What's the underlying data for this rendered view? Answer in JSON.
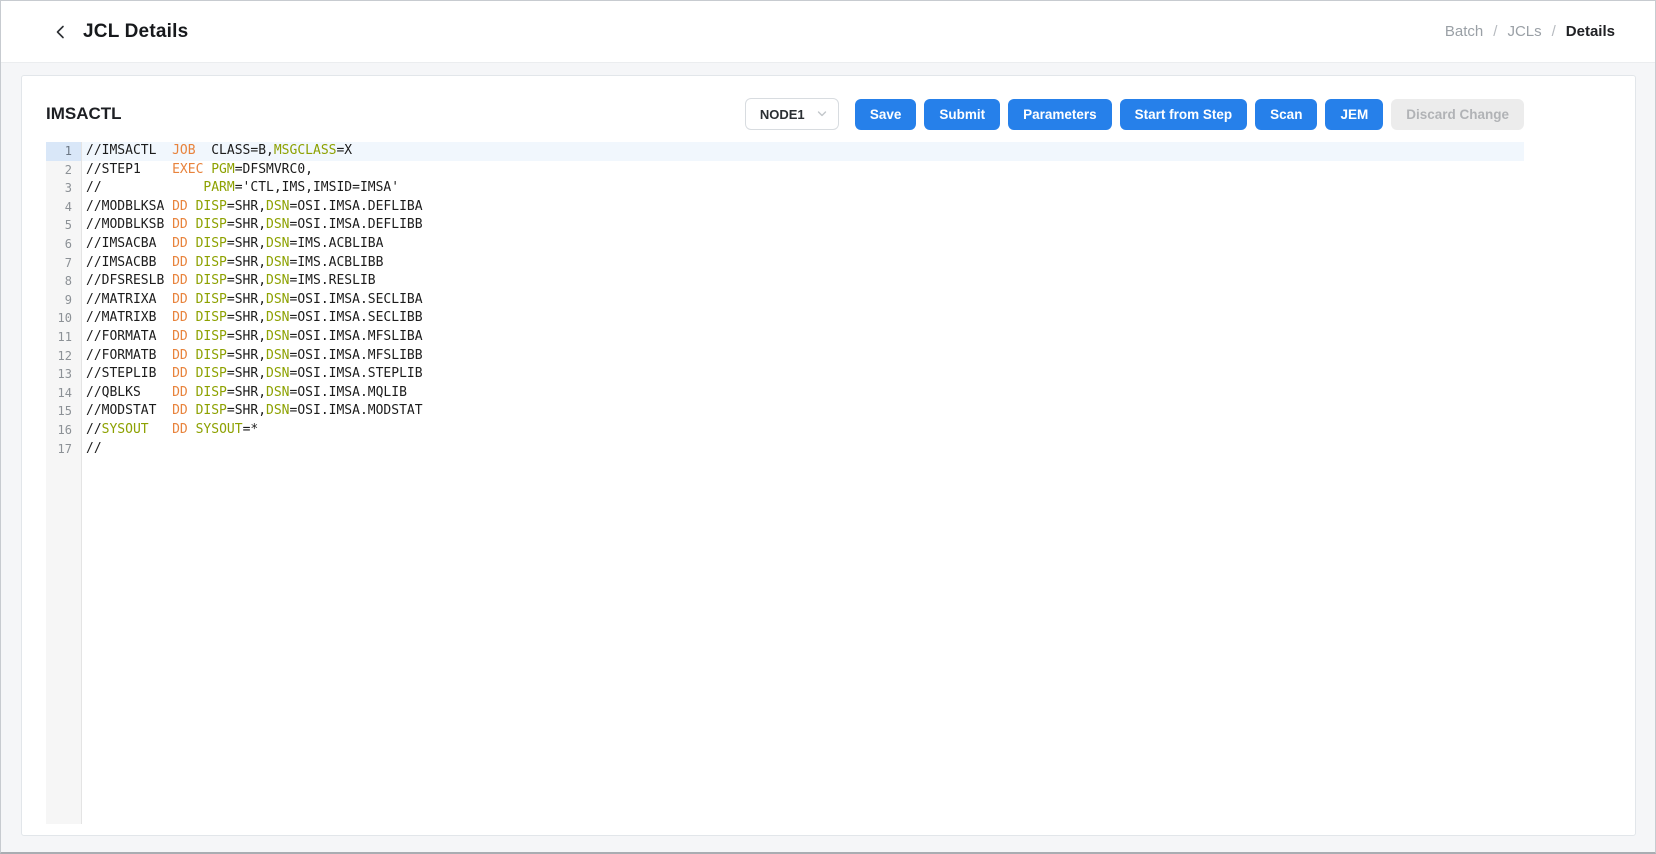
{
  "colors": {
    "accent_blue": "#2680EA",
    "keyword_orange": "#E8833C",
    "keyword_green": "#8DA101",
    "code_text": "#1C1C1C",
    "active_line_bg": "#F1F7FD",
    "active_gutter_bg": "#D9E7F8"
  },
  "header": {
    "title": "JCL Details",
    "back_icon": "chevron-left-icon",
    "breadcrumb": {
      "separator": "/",
      "items": [
        {
          "label": "Batch",
          "active": false
        },
        {
          "label": "JCLs",
          "active": false
        },
        {
          "label": "Details",
          "active": true
        }
      ]
    }
  },
  "card": {
    "title": "IMSACTL",
    "toolbar": {
      "node_select": {
        "value": "NODE1",
        "chevron_icon": "chevron-down-icon"
      },
      "buttons": [
        {
          "label": "Save",
          "name": "save-button",
          "enabled": true
        },
        {
          "label": "Submit",
          "name": "submit-button",
          "enabled": true
        },
        {
          "label": "Parameters",
          "name": "parameters-button",
          "enabled": true
        },
        {
          "label": "Start from Step",
          "name": "start-from-step-button",
          "enabled": true
        },
        {
          "label": "Scan",
          "name": "scan-button",
          "enabled": true
        },
        {
          "label": "JEM",
          "name": "jem-button",
          "enabled": true
        },
        {
          "label": "Discard Change",
          "name": "discard-change-button",
          "enabled": false
        }
      ]
    }
  },
  "editor": {
    "active_line": 1,
    "line_count": 17,
    "lines": [
      {
        "no": 1,
        "segments": [
          {
            "text": "//IMSACTL  ",
            "style": "plain"
          },
          {
            "text": "JOB",
            "style": "operator"
          },
          {
            "text": "  CLASS=B,",
            "style": "plain"
          },
          {
            "text": "MSGCLASS",
            "style": "keyword"
          },
          {
            "text": "=X",
            "style": "plain"
          }
        ]
      },
      {
        "no": 2,
        "segments": [
          {
            "text": "//STEP1    ",
            "style": "plain"
          },
          {
            "text": "EXEC",
            "style": "operator"
          },
          {
            "text": " ",
            "style": "plain"
          },
          {
            "text": "PGM",
            "style": "keyword"
          },
          {
            "text": "=DFSMVRC0,",
            "style": "plain"
          }
        ]
      },
      {
        "no": 3,
        "segments": [
          {
            "text": "//             ",
            "style": "plain"
          },
          {
            "text": "PARM",
            "style": "keyword"
          },
          {
            "text": "='CTL,IMS,IMSID=IMSA'",
            "style": "plain"
          }
        ]
      },
      {
        "no": 4,
        "segments": [
          {
            "text": "//MODBLKSA ",
            "style": "plain"
          },
          {
            "text": "DD",
            "style": "operator"
          },
          {
            "text": " ",
            "style": "plain"
          },
          {
            "text": "DISP",
            "style": "keyword"
          },
          {
            "text": "=SHR,",
            "style": "plain"
          },
          {
            "text": "DSN",
            "style": "keyword"
          },
          {
            "text": "=OSI.IMSA.DEFLIBA",
            "style": "plain"
          }
        ]
      },
      {
        "no": 5,
        "segments": [
          {
            "text": "//MODBLKSB ",
            "style": "plain"
          },
          {
            "text": "DD",
            "style": "operator"
          },
          {
            "text": " ",
            "style": "plain"
          },
          {
            "text": "DISP",
            "style": "keyword"
          },
          {
            "text": "=SHR,",
            "style": "plain"
          },
          {
            "text": "DSN",
            "style": "keyword"
          },
          {
            "text": "=OSI.IMSA.DEFLIBB",
            "style": "plain"
          }
        ]
      },
      {
        "no": 6,
        "segments": [
          {
            "text": "//IMSACBA  ",
            "style": "plain"
          },
          {
            "text": "DD",
            "style": "operator"
          },
          {
            "text": " ",
            "style": "plain"
          },
          {
            "text": "DISP",
            "style": "keyword"
          },
          {
            "text": "=SHR,",
            "style": "plain"
          },
          {
            "text": "DSN",
            "style": "keyword"
          },
          {
            "text": "=IMS.ACBLIBA",
            "style": "plain"
          }
        ]
      },
      {
        "no": 7,
        "segments": [
          {
            "text": "//IMSACBB  ",
            "style": "plain"
          },
          {
            "text": "DD",
            "style": "operator"
          },
          {
            "text": " ",
            "style": "plain"
          },
          {
            "text": "DISP",
            "style": "keyword"
          },
          {
            "text": "=SHR,",
            "style": "plain"
          },
          {
            "text": "DSN",
            "style": "keyword"
          },
          {
            "text": "=IMS.ACBLIBB",
            "style": "plain"
          }
        ]
      },
      {
        "no": 8,
        "segments": [
          {
            "text": "//DFSRESLB ",
            "style": "plain"
          },
          {
            "text": "DD",
            "style": "operator"
          },
          {
            "text": " ",
            "style": "plain"
          },
          {
            "text": "DISP",
            "style": "keyword"
          },
          {
            "text": "=SHR,",
            "style": "plain"
          },
          {
            "text": "DSN",
            "style": "keyword"
          },
          {
            "text": "=IMS.RESLIB",
            "style": "plain"
          }
        ]
      },
      {
        "no": 9,
        "segments": [
          {
            "text": "//MATRIXA  ",
            "style": "plain"
          },
          {
            "text": "DD",
            "style": "operator"
          },
          {
            "text": " ",
            "style": "plain"
          },
          {
            "text": "DISP",
            "style": "keyword"
          },
          {
            "text": "=SHR,",
            "style": "plain"
          },
          {
            "text": "DSN",
            "style": "keyword"
          },
          {
            "text": "=OSI.IMSA.SECLIBA",
            "style": "plain"
          }
        ]
      },
      {
        "no": 10,
        "segments": [
          {
            "text": "//MATRIXB  ",
            "style": "plain"
          },
          {
            "text": "DD",
            "style": "operator"
          },
          {
            "text": " ",
            "style": "plain"
          },
          {
            "text": "DISP",
            "style": "keyword"
          },
          {
            "text": "=SHR,",
            "style": "plain"
          },
          {
            "text": "DSN",
            "style": "keyword"
          },
          {
            "text": "=OSI.IMSA.SECLIBB",
            "style": "plain"
          }
        ]
      },
      {
        "no": 11,
        "segments": [
          {
            "text": "//FORMATA  ",
            "style": "plain"
          },
          {
            "text": "DD",
            "style": "operator"
          },
          {
            "text": " ",
            "style": "plain"
          },
          {
            "text": "DISP",
            "style": "keyword"
          },
          {
            "text": "=SHR,",
            "style": "plain"
          },
          {
            "text": "DSN",
            "style": "keyword"
          },
          {
            "text": "=OSI.IMSA.MFSLIBA",
            "style": "plain"
          }
        ]
      },
      {
        "no": 12,
        "segments": [
          {
            "text": "//FORMATB  ",
            "style": "plain"
          },
          {
            "text": "DD",
            "style": "operator"
          },
          {
            "text": " ",
            "style": "plain"
          },
          {
            "text": "DISP",
            "style": "keyword"
          },
          {
            "text": "=SHR,",
            "style": "plain"
          },
          {
            "text": "DSN",
            "style": "keyword"
          },
          {
            "text": "=OSI.IMSA.MFSLIBB",
            "style": "plain"
          }
        ]
      },
      {
        "no": 13,
        "segments": [
          {
            "text": "//STEPLIB  ",
            "style": "plain"
          },
          {
            "text": "DD",
            "style": "operator"
          },
          {
            "text": " ",
            "style": "plain"
          },
          {
            "text": "DISP",
            "style": "keyword"
          },
          {
            "text": "=SHR,",
            "style": "plain"
          },
          {
            "text": "DSN",
            "style": "keyword"
          },
          {
            "text": "=OSI.IMSA.STEPLIB",
            "style": "plain"
          }
        ]
      },
      {
        "no": 14,
        "segments": [
          {
            "text": "//QBLKS    ",
            "style": "plain"
          },
          {
            "text": "DD",
            "style": "operator"
          },
          {
            "text": " ",
            "style": "plain"
          },
          {
            "text": "DISP",
            "style": "keyword"
          },
          {
            "text": "=SHR,",
            "style": "plain"
          },
          {
            "text": "DSN",
            "style": "keyword"
          },
          {
            "text": "=OSI.IMSA.MQLIB",
            "style": "plain"
          }
        ]
      },
      {
        "no": 15,
        "segments": [
          {
            "text": "//MODSTAT  ",
            "style": "plain"
          },
          {
            "text": "DD",
            "style": "operator"
          },
          {
            "text": " ",
            "style": "plain"
          },
          {
            "text": "DISP",
            "style": "keyword"
          },
          {
            "text": "=SHR,",
            "style": "plain"
          },
          {
            "text": "DSN",
            "style": "keyword"
          },
          {
            "text": "=OSI.IMSA.MODSTAT",
            "style": "plain"
          }
        ]
      },
      {
        "no": 16,
        "segments": [
          {
            "text": "//",
            "style": "plain"
          },
          {
            "text": "SYSOUT",
            "style": "keyword"
          },
          {
            "text": "   ",
            "style": "plain"
          },
          {
            "text": "DD",
            "style": "operator"
          },
          {
            "text": " ",
            "style": "plain"
          },
          {
            "text": "SYSOUT",
            "style": "keyword"
          },
          {
            "text": "=*",
            "style": "plain"
          }
        ]
      },
      {
        "no": 17,
        "segments": [
          {
            "text": "//",
            "style": "plain"
          }
        ]
      }
    ]
  }
}
